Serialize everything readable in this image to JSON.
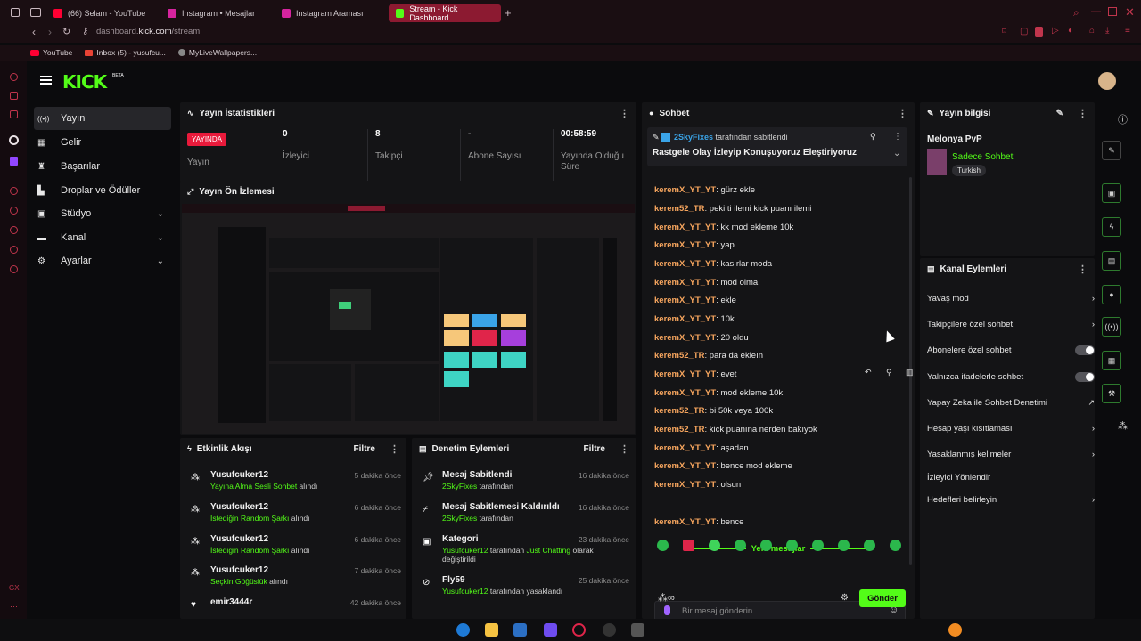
{
  "browser": {
    "tabs": [
      {
        "label": "(66) Selam - YouTube",
        "color": "#ff0033"
      },
      {
        "label": "Instagram • Mesajlar",
        "color": "#d6249f"
      },
      {
        "label": "Instagram Araması",
        "color": "#d6249f"
      },
      {
        "label": "Stream - Kick Dashboard",
        "color": "#53fc18"
      }
    ],
    "address": "dashboard.kick.com/stream",
    "address_host": "dashboard.",
    "address_domain": "kick.com",
    "address_path": "/stream",
    "bookmarks": [
      "YouTube",
      "Inbox (5) - yusufcu...",
      "MyLiveWallpapers..."
    ]
  },
  "app": {
    "logo": "KICK",
    "logo_badge": "BETA",
    "nav": [
      {
        "label": "Yayın",
        "icon": "stream-icon",
        "glyph": "((•))"
      },
      {
        "label": "Gelir",
        "icon": "revenue-icon",
        "glyph": "▦"
      },
      {
        "label": "Başarılar",
        "icon": "trophy-icon",
        "glyph": "🏆"
      },
      {
        "label": "Droplar ve Ödüller",
        "icon": "drops-icon",
        "glyph": "▙"
      },
      {
        "label": "Stüdyo",
        "icon": "studio-icon",
        "glyph": "⚙"
      },
      {
        "label": "Kanal",
        "icon": "channel-icon",
        "glyph": "▬"
      },
      {
        "label": "Ayarlar",
        "icon": "settings-icon",
        "glyph": "⚙"
      }
    ]
  },
  "stats": {
    "title": "Yayın İstatistikleri",
    "live_badge": "YAYINDA",
    "live_label": "Yayın",
    "cells": [
      {
        "value": "0",
        "label": "İzleyici"
      },
      {
        "value": "8",
        "label": "Takipçi"
      },
      {
        "value": "-",
        "label": "Abone Sayısı"
      },
      {
        "value": "00:58:59",
        "label": "Yayında Olduğu Süre"
      }
    ]
  },
  "preview": {
    "title": "Yayın Ön İzlemesi"
  },
  "activity": {
    "title": "Etkinlik Akışı",
    "filter": "Filtre",
    "items": [
      {
        "user": "Yusufcuker12",
        "highlight": "Yayına Alma Sesli Sohbet",
        "suffix": " alındı",
        "time": "5 dakika önce"
      },
      {
        "user": "Yusufcuker12",
        "highlight": "İstediğin Random Şarkı",
        "suffix": " alındı",
        "time": "6 dakika önce"
      },
      {
        "user": "Yusufcuker12",
        "highlight": "İstediğin Random Şarkı",
        "suffix": " alındı",
        "time": "6 dakika önce"
      },
      {
        "user": "Yusufcuker12",
        "highlight": "Seçkin Göğüslük",
        "suffix": " alındı",
        "time": "7 dakika önce"
      },
      {
        "user": "emir3444r",
        "highlight": "",
        "suffix": "",
        "time": "42 dakika önce"
      }
    ]
  },
  "moderation": {
    "title": "Denetim Eylemleri",
    "filter": "Filtre",
    "items": [
      {
        "title": "Mesaj Sabitlendi",
        "highlight": "2SkyFixes",
        "suffix": " tarafından",
        "time": "16 dakika önce"
      },
      {
        "title": "Mesaj Sabitlemesi Kaldırıldı",
        "highlight": "2SkyFixes",
        "suffix": " tarafından",
        "time": "16 dakika önce"
      },
      {
        "title": "Kategori",
        "highlight": "Yusufcuker12",
        "suffix": " tarafından ",
        "extra": "Just Chatting",
        "suffix2": " olarak değiştirildi",
        "time": "23 dakika önce"
      },
      {
        "title": "Fly59",
        "highlight": "Yusufcuker12",
        "suffix": " tarafından yasaklandı",
        "time": "25 dakika önce"
      }
    ]
  },
  "chat": {
    "title": "Sohbet",
    "pinned_by_user": "2SkyFixes",
    "pinned_by_suffix": " tarafından sabitlendi",
    "pinned_text": "Rastgele Olay İzleyip Konuşuyoruz Eleştiriyoruz",
    "messages": [
      {
        "user": "keremX_YT_YT",
        "text": "gürz ekle"
      },
      {
        "user": "kerem52_TR",
        "text": "peki ti ilemi kick puanı ilemi"
      },
      {
        "user": "keremX_YT_YT",
        "text": "kk mod ekleme 10k"
      },
      {
        "user": "keremX_YT_YT",
        "text": "yap"
      },
      {
        "user": "keremX_YT_YT",
        "text": "kasırlar moda"
      },
      {
        "user": "keremX_YT_YT",
        "text": "mod olma"
      },
      {
        "user": "keremX_YT_YT",
        "text": "ekle"
      },
      {
        "user": "keremX_YT_YT",
        "text": "10k"
      },
      {
        "user": "keremX_YT_YT",
        "text": "20 oldu"
      },
      {
        "user": "kerem52_TR",
        "text": "para da ekleın"
      },
      {
        "user": "keremX_YT_YT",
        "text": "evet"
      },
      {
        "user": "keremX_YT_YT",
        "text": "mod ekleme 10k"
      },
      {
        "user": "kerem52_TR",
        "text": "bi 50k veya 100k"
      },
      {
        "user": "kerem52_TR",
        "text": "kick puanına nerden bakıyok"
      },
      {
        "user": "keremX_YT_YT",
        "text": "aşadan"
      },
      {
        "user": "keremX_YT_YT",
        "text": "bence mod ekleme"
      },
      {
        "user": "keremX_YT_YT",
        "text": "olsun"
      }
    ],
    "new_messages_label": "Yeni mesajlar",
    "new_message": {
      "user": "keremX_YT_YT",
      "text": "bence"
    },
    "input_placeholder": "Bir mesaj gönderin",
    "send_label": "Gönder",
    "sep": ": "
  },
  "stream_info": {
    "title": "Yayın bilgisi",
    "stream_title": "Melonya PvP",
    "chat_mode": "Sadece Sohbet",
    "language": "Turkish"
  },
  "channel_actions": {
    "title": "Kanal Eylemleri",
    "items": [
      {
        "label": "Yavaş mod",
        "control": "chevron"
      },
      {
        "label": "Takipçilere özel sohbet",
        "control": "chevron"
      },
      {
        "label": "Abonelere özel sohbet",
        "control": "toggle"
      },
      {
        "label": "Yalnızca ifadelerle sohbet",
        "control": "toggle"
      },
      {
        "label": "Yapay Zeka ile Sohbet Denetimi",
        "control": "external"
      },
      {
        "label": "Hesap yaşı kısıtlaması",
        "control": "chevron"
      },
      {
        "label": "Yasaklanmış kelimeler",
        "control": "chevron"
      },
      {
        "label": "İzleyici Yönlendir",
        "control": "none"
      },
      {
        "label": "Hedefleri belirleyin",
        "control": "chevron"
      }
    ]
  },
  "colors": {
    "accent": "#53fc18",
    "live": "#e91a3b",
    "username": "#f6a55e"
  }
}
